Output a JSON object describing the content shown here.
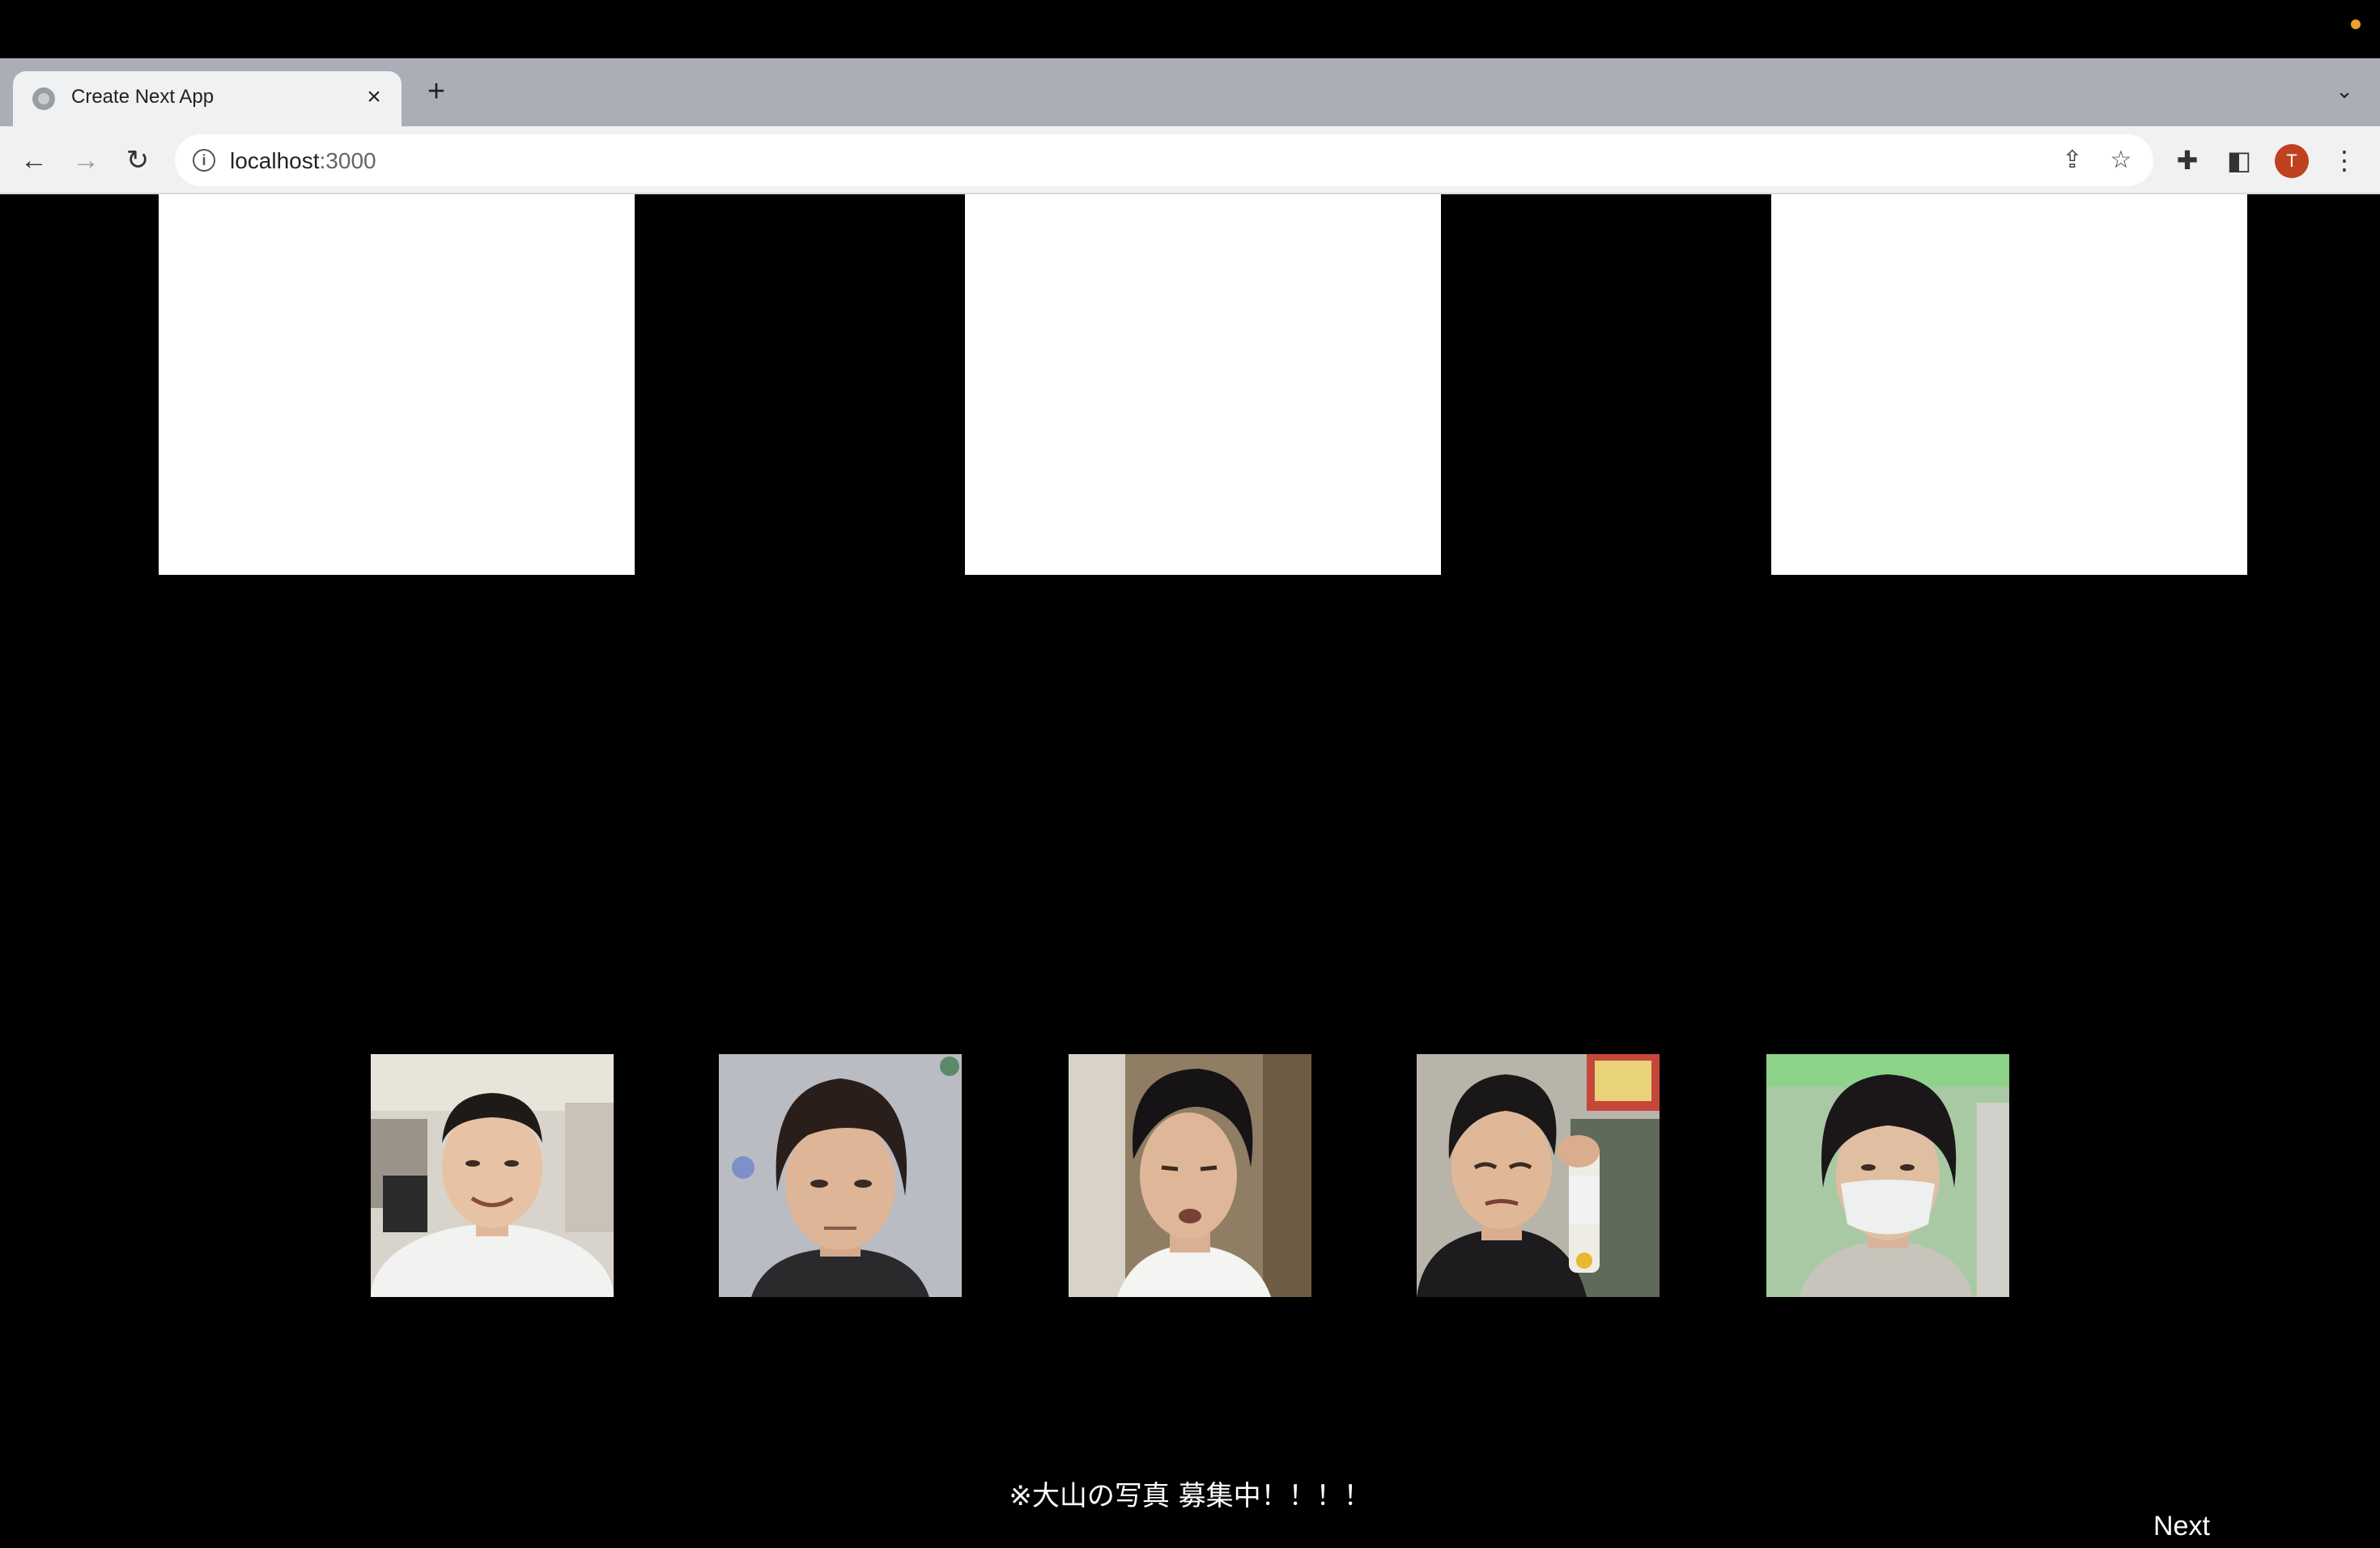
{
  "browser": {
    "tab_title": "Create Next App",
    "url_host": "localhost",
    "url_port": ":3000",
    "avatar_initial": "T"
  },
  "icons": {
    "close": "×",
    "new_tab": "+",
    "dropdown": "⌄",
    "back": "←",
    "forward": "→",
    "reload": "↻",
    "info": "i",
    "share": "⇪",
    "star": "☆",
    "extensions": "✚",
    "side_panel": "◧",
    "menu": "⋮"
  },
  "page": {
    "notice": "※大山の写真 募集中！！！！",
    "next_label": "Next"
  },
  "colors": {
    "background": "#000000",
    "card": "#ffffff",
    "avatar": "#c0401f"
  }
}
